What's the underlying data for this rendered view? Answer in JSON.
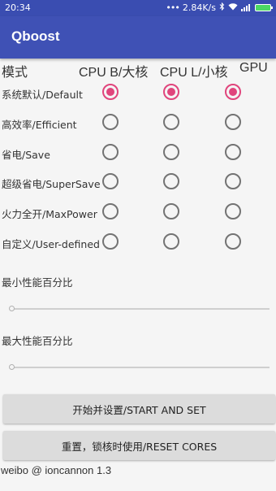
{
  "status_bar": {
    "time": "20:34",
    "dots": "•••",
    "speed": "2.84K/s",
    "icons": [
      "bluetooth-icon",
      "wifi-icon",
      "signal-icon",
      "battery-icon"
    ]
  },
  "app_bar": {
    "title": "Qboost"
  },
  "table": {
    "headers": [
      "模式",
      "CPU B/大核",
      "CPU L/小核",
      "GPU"
    ],
    "rows": [
      {
        "label": "系统默认/Default",
        "selected": [
          true,
          true,
          true
        ]
      },
      {
        "label": "高效率/Efficient",
        "selected": [
          false,
          false,
          false
        ]
      },
      {
        "label": "省电/Save",
        "selected": [
          false,
          false,
          false
        ]
      },
      {
        "label": "超级省电/SuperSave",
        "selected": [
          false,
          false,
          false
        ]
      },
      {
        "label": "火力全开/MaxPower",
        "selected": [
          false,
          false,
          false
        ]
      },
      {
        "label": "自定义/User-defined",
        "selected": [
          false,
          false,
          false
        ]
      }
    ]
  },
  "sliders": {
    "min_label": "最小性能百分比",
    "min_value": 0,
    "max_label": "最大性能百分比",
    "max_value": 0
  },
  "buttons": {
    "start": "开始并设置/START AND SET",
    "reset": "重置，锁核时使用/RESET CORES"
  },
  "footer": "weibo @ ioncannon 1.3",
  "colors": {
    "app_bar": "#3f51b5",
    "status_bar": "#3a4db1",
    "radio_checked": "#e0457c"
  }
}
